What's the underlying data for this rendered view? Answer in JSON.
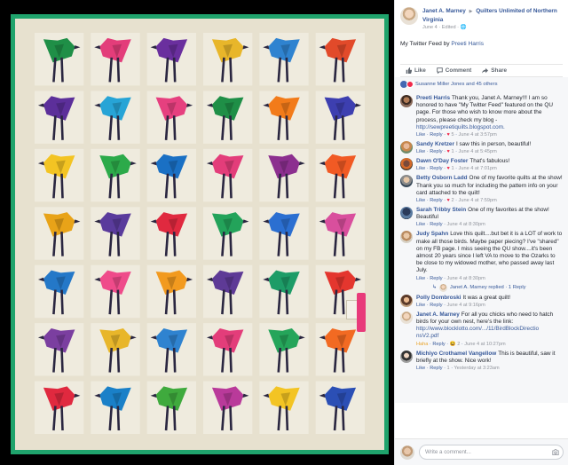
{
  "quilt": {
    "colors": {
      "border": "#1fa36c",
      "background": "#e7e1cf",
      "block_light": "#f1ede1",
      "legs": "#2a2640",
      "tag": "#e83a7a"
    },
    "bird_colors": [
      [
        "#1f8f47",
        "#e33d7a",
        "#6a2f9e",
        "#e8b62a",
        "#2f83d0",
        "#e24a2a"
      ],
      [
        "#5c2f9a",
        "#27a4d6",
        "#e6407f",
        "#1f8f47",
        "#f27b1a",
        "#3d3fb0"
      ],
      [
        "#f3c423",
        "#2caa4a",
        "#1a70c4",
        "#e33d7a",
        "#8c2f8f",
        "#f15a24"
      ],
      [
        "#e8a318",
        "#5a3b9c",
        "#e0293f",
        "#23a35a",
        "#2b6fd1",
        "#d94f9d"
      ],
      [
        "#2478c8",
        "#ef4b8a",
        "#f29a1f",
        "#5e3a96",
        "#1d9c67",
        "#e4362e"
      ],
      [
        "#7b3fa0",
        "#e8b62a",
        "#2f83d0",
        "#e33d7a",
        "#25a55a",
        "#f26a22"
      ],
      [
        "#e0293f",
        "#1a80c8",
        "#3faa3d",
        "#b93a9a",
        "#f3c423",
        "#2b4fb5"
      ]
    ]
  },
  "post": {
    "author": "Janet A. Marney",
    "group": "Quilters Unlimited of Northern Virginia",
    "meta": "June 4 · Edited ·",
    "text": "My Twitter Feed by ",
    "text_link": "Preeti Harris"
  },
  "actions": {
    "like": "Like",
    "comment": "Comment",
    "share": "Share"
  },
  "reactions": {
    "text": "Susanne Miller Jones and 45 others"
  },
  "comments": [
    {
      "avatar": "av-preeti",
      "name": "Preeti Harris",
      "text": "Thank you, Janet A. Marney!!! I am so honored to have \"My Twitter Feed\" featured on the QU page. For those who wish to know more about the process, please check my blog - ",
      "link": "http://sewpreetiquilts.blogspot.com.",
      "like": "Like",
      "reply": "Reply",
      "reaction": "♥",
      "count": "5",
      "time": "June 4 at 3:57pm"
    },
    {
      "avatar": "av-sandy",
      "name": "Sandy Kretzer",
      "text": "I saw this in person, beautiful!",
      "like": "Like",
      "reply": "Reply",
      "reaction": "♥",
      "count": "1",
      "time": "June 4 at 5:45pm"
    },
    {
      "avatar": "av-dawn",
      "name": "Dawn O'Day Foster",
      "text": "That's fabulous!",
      "like": "Like",
      "reply": "Reply",
      "reaction": "♥",
      "count": "1",
      "time": "June 4 at 7:01pm"
    },
    {
      "avatar": "av-betty",
      "name": "Betty Osborn Ladd",
      "text": "One of my favorite quilts at the show! Thank you so much for including the pattern info on your card attached to the quilt!",
      "like": "Like",
      "reply": "Reply",
      "reaction": "♥",
      "count": "2",
      "time": "June 4 at 7:59pm"
    },
    {
      "avatar": "av-sarah",
      "name": "Sarah Tribby Stein",
      "text": "One of my favorites at the show! Beautiful",
      "like": "Like",
      "reply": "Reply",
      "reaction": "",
      "count": "",
      "time": "June 4 at 8:30pm"
    },
    {
      "avatar": "av-judy",
      "name": "Judy Spahn",
      "text": "Love this quilt....but bet it is a LOT of work to make all those birds. Maybe paper piecing? I've \"shared\" on my FB page. I miss seeing the QU show....it's been almost 20 years since I left VA to move to the Ozarks to be close to my widowed mother, who passed away last July.",
      "like": "Like",
      "reply": "Reply",
      "reaction": "",
      "count": "",
      "time": "June 4 at 8:30pm",
      "reply_summary": "Janet A. Marney replied · 1 Reply"
    },
    {
      "avatar": "av-polly",
      "name": "Polly Dombroski",
      "text": "It was a great quilt!",
      "like": "Like",
      "reply": "Reply",
      "reaction": "",
      "count": "",
      "time": "June 4 at 9:16pm"
    },
    {
      "avatar": "av-janet",
      "name": "Janet A. Marney",
      "text": "For all you chicks who need to hatch birds for your own nest, here's the link: ",
      "link": "http://www.blocklotto.com/.../11/BirdBlockDirectio nsV2.pdf",
      "like": "Haha",
      "reply": "Reply",
      "reaction": "😆",
      "count": "2",
      "time": "June 4 at 10:27pm",
      "haha": true
    },
    {
      "avatar": "av-michiyo",
      "name": "Michiyo Crothamel Vangellow",
      "text": "This is beautiful, saw it briefly at the show. Nice work!",
      "like": "Like",
      "reply": "Reply",
      "reaction": "",
      "count": "1",
      "time": "Yesterday at 3:23am"
    }
  ],
  "write": {
    "placeholder": "Write a comment..."
  }
}
